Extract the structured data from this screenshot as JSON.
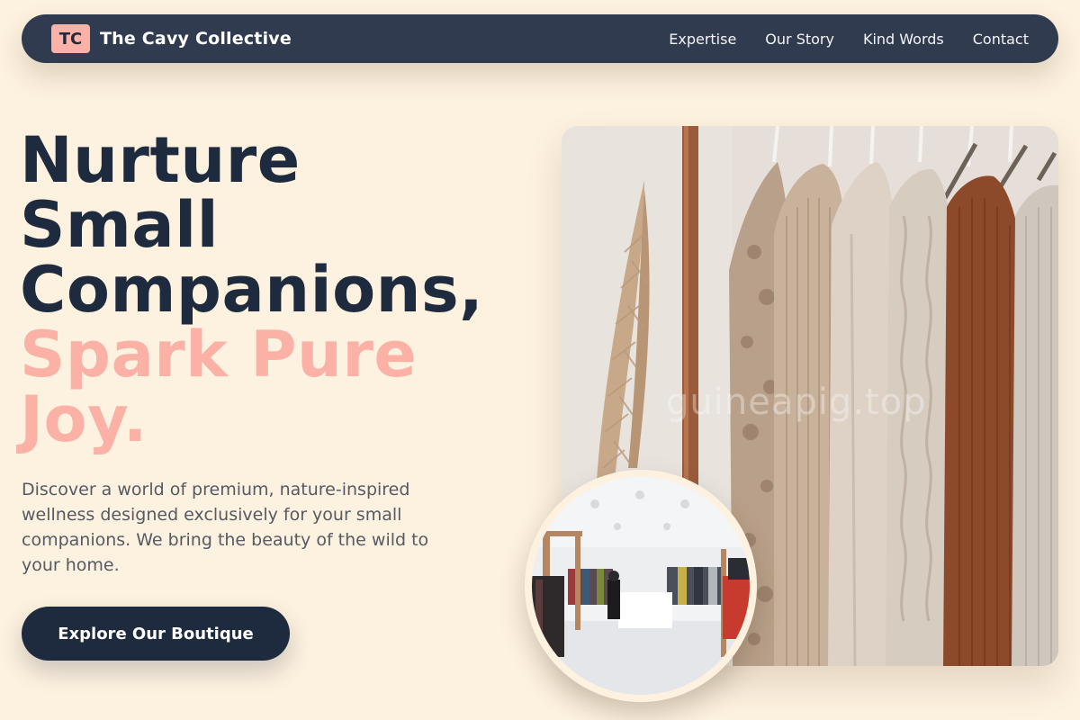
{
  "brand": {
    "badge": "TC",
    "name": "The Cavy Collective",
    "badge_color": "#fbb1a6"
  },
  "nav": {
    "links": [
      {
        "label": "Expertise"
      },
      {
        "label": "Our Story"
      },
      {
        "label": "Kind Words"
      },
      {
        "label": "Contact"
      }
    ]
  },
  "hero": {
    "title_lines": [
      "Nurture",
      "Small",
      "Companions,"
    ],
    "accent_lines": [
      "Spark Pure",
      "Joy."
    ],
    "description": "Discover a world of premium, nature-inspired wellness designed exclusively for your small companions. We bring the beauty of the wild to your home.",
    "cta_label": "Explore Our Boutique"
  },
  "images": {
    "main_icon": "clothing-rack-photo",
    "main_watermark": "guineapig.top",
    "circle_icon": "boutique-interior-photo"
  },
  "colors": {
    "background": "#fdf1df",
    "navbar": "#313b4f",
    "heading": "#1e2a3d",
    "accent": "#fbb1a6",
    "body_text": "#555a63"
  }
}
